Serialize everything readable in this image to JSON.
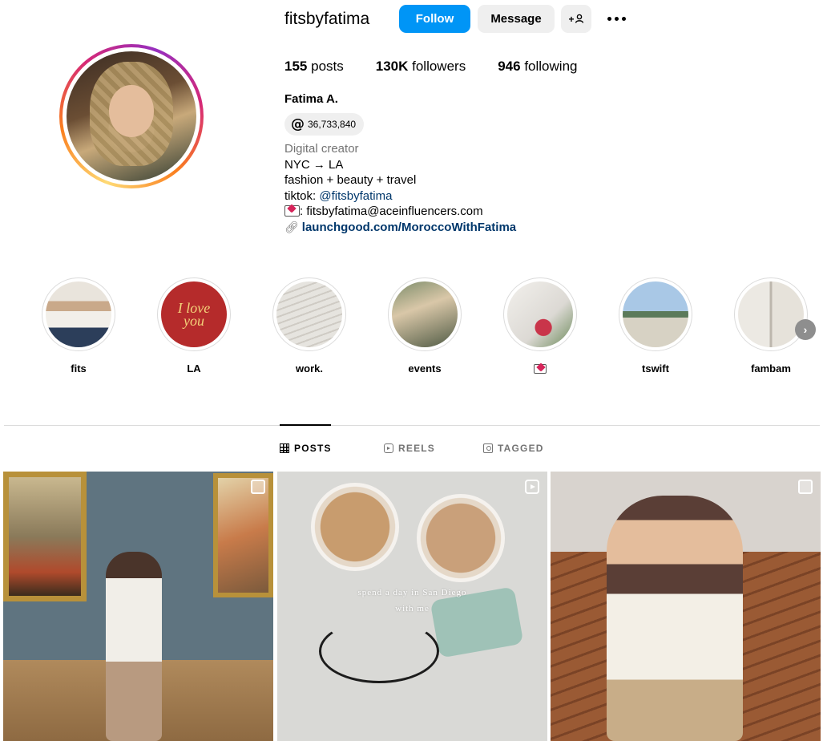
{
  "profile": {
    "username": "fitsbyfatima",
    "follow_label": "Follow",
    "message_label": "Message",
    "add_user_glyph": "+👤",
    "stats": {
      "posts_count": "155",
      "posts_label": "posts",
      "followers_count": "130K",
      "followers_label": "followers",
      "following_count": "946",
      "following_label": "following"
    },
    "full_name": "Fatima A.",
    "threads_count": "36,733,840",
    "bio": {
      "category": "Digital creator",
      "line1": "NYC → LA",
      "line2": "fashion + beauty + travel",
      "tiktok_prefix": "tiktok: ",
      "tiktok_handle": "@fitsbyfatima",
      "email_text": ": fitsbyfatima@aceinfluencers.com",
      "external_link": "launchgood.com/MoroccoWithFatima"
    }
  },
  "highlights": [
    {
      "label": "fits"
    },
    {
      "label": "LA"
    },
    {
      "label": "work."
    },
    {
      "label": "events"
    },
    {
      "label": ""
    },
    {
      "label": "tswift"
    },
    {
      "label": "fambam"
    }
  ],
  "tabs": {
    "posts": "POSTS",
    "reels": "REELS",
    "tagged": "TAGGED"
  },
  "posts": [
    {
      "caption_line1": "",
      "caption_line2": "",
      "badge": "multi-photo-icon"
    },
    {
      "caption_line1": "spend a day in San Diego",
      "caption_line2": "with me",
      "badge": "reel-icon"
    },
    {
      "caption_line1": "",
      "caption_line2": "",
      "badge": "multi-photo-icon"
    }
  ],
  "colors": {
    "follow_button": "#0095f6",
    "secondary_button": "#efefef",
    "link": "#00376b",
    "muted": "#737373"
  }
}
